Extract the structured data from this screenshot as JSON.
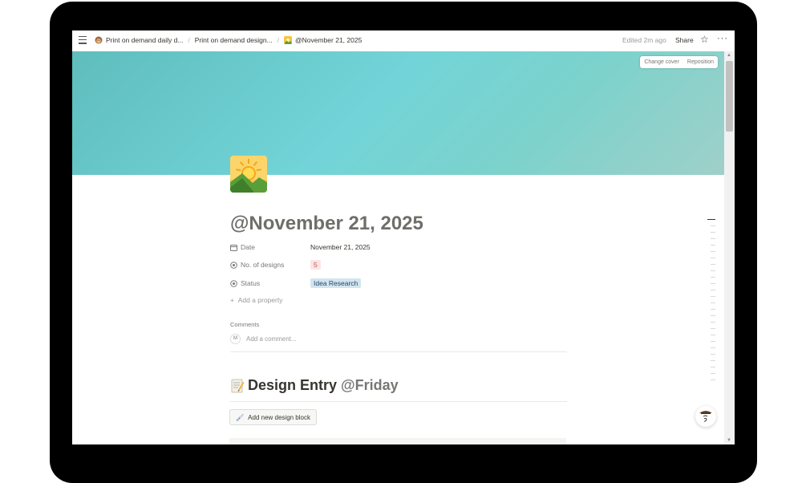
{
  "breadcrumb": {
    "items": [
      {
        "label": "Print on demand daily d...",
        "icon": "monkey-icon"
      },
      {
        "label": "Print on demand design...",
        "icon": ""
      },
      {
        "label": "@November 21, 2025",
        "icon": "sunrise-icon"
      }
    ],
    "separator": "/"
  },
  "topbar": {
    "edited": "Edited 2m ago",
    "share": "Share",
    "star_icon": "☆",
    "more_icon": "···"
  },
  "cover": {
    "change_cover": "Change cover",
    "reposition": "Reposition",
    "colors": [
      "#5fbdbd",
      "#72d4d8",
      "#9fd0c9"
    ]
  },
  "page": {
    "title": "@November 21, 2025",
    "properties": [
      {
        "icon": "calendar-icon",
        "label": "Date",
        "value": "November 21, 2025",
        "style": "plain"
      },
      {
        "icon": "status-icon",
        "label": "No. of designs",
        "value": "5",
        "style": "red"
      },
      {
        "icon": "status-icon",
        "label": "Status",
        "value": "Idea Research",
        "style": "blue"
      }
    ],
    "add_property": "Add a property",
    "comments": {
      "heading": "Comments",
      "avatar_initial": "M",
      "placeholder": "Add a comment..."
    },
    "section": {
      "heading": "Design Entry",
      "mention": "@Friday"
    },
    "add_block_button": "Add new design block"
  }
}
